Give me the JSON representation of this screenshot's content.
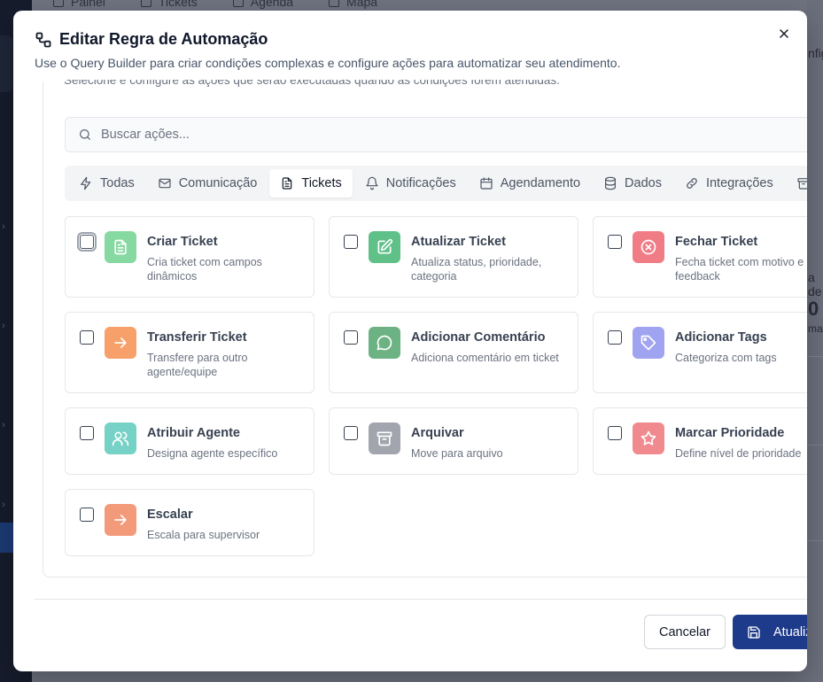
{
  "background": {
    "nav": [
      "Painel",
      "Tickets",
      "Agenda",
      "Mapa"
    ],
    "right_texts": [
      "nfig",
      "a de",
      "0",
      "ma"
    ]
  },
  "modal": {
    "title": "Editar Regra de Automação",
    "description": "Use o Query Builder para criar condições complexas e configure ações para automatizar seu atendimento.",
    "section_description": "Selecione e configure as ações que serão executadas quando as condições forem atendidas.",
    "search": {
      "placeholder": "Buscar ações..."
    },
    "tabs": [
      {
        "label": "Todas",
        "icon": "zap-icon"
      },
      {
        "label": "Comunicação",
        "icon": "mail-icon"
      },
      {
        "label": "Tickets",
        "icon": "file-text-icon",
        "active": true
      },
      {
        "label": "Notificações",
        "icon": "bell-icon"
      },
      {
        "label": "Agendamento",
        "icon": "calendar-icon"
      },
      {
        "label": "Dados",
        "icon": "database-icon"
      },
      {
        "label": "Integrações",
        "icon": "link-icon"
      }
    ],
    "actions": [
      {
        "name": "Criar Ticket",
        "description": "Cria ticket com campos dinâmicos",
        "icon": "file-text-icon",
        "color": "#86d9a0"
      },
      {
        "name": "Atualizar Ticket",
        "description": "Atualiza status, prioridade, categoria",
        "icon": "edit-icon",
        "color": "#5fc088"
      },
      {
        "name": "Fechar Ticket",
        "description": "Fecha ticket com motivo e feedback",
        "icon": "x-circle-icon",
        "color": "#f07d86"
      },
      {
        "name": "Transferir Ticket",
        "description": "Transfere para outro agente/equipe",
        "icon": "arrow-right-icon",
        "color": "#f7a069"
      },
      {
        "name": "Adicionar Comentário",
        "description": "Adiciona comentário em ticket",
        "icon": "message-circle-icon",
        "color": "#6cb282"
      },
      {
        "name": "Adicionar Tags",
        "description": "Categoriza com tags",
        "icon": "tag-icon",
        "color": "#a0a3f0"
      },
      {
        "name": "Atribuir Agente",
        "description": "Designa agente específico",
        "icon": "users-icon",
        "color": "#76d1c6"
      },
      {
        "name": "Arquivar",
        "description": "Move para arquivo",
        "icon": "archive-icon",
        "color": "#a2a5ae"
      },
      {
        "name": "Marcar Prioridade",
        "description": "Define nível de prioridade",
        "icon": "star-icon",
        "color": "#f18a8f"
      },
      {
        "name": "Escalar",
        "description": "Escala para supervisor",
        "icon": "arrow-right-icon",
        "color": "#f39a7b"
      }
    ],
    "footer": {
      "cancel_label": "Cancelar",
      "save_label": "Atualizar"
    }
  }
}
